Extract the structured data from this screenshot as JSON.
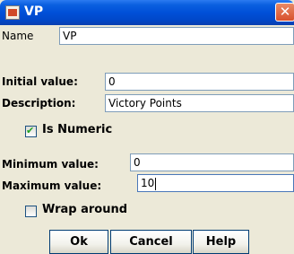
{
  "dialog": {
    "title": "VP",
    "close_glyph": "✕"
  },
  "form": {
    "name_label": "Name",
    "name_value": "VP",
    "initial_label": "Initial value:",
    "initial_value": "0",
    "description_label": "Description:",
    "description_value": "Victory Points",
    "numeric_label": "Is Numeric",
    "numeric_checked": true,
    "check_glyph": "✔",
    "min_label": "Minimum value:",
    "min_value": "0",
    "max_label": "Maximum value:",
    "max_value": "10",
    "wrap_label": "Wrap around",
    "wrap_checked": false
  },
  "buttons": {
    "ok": "Ok",
    "cancel": "Cancel",
    "help": "Help"
  }
}
